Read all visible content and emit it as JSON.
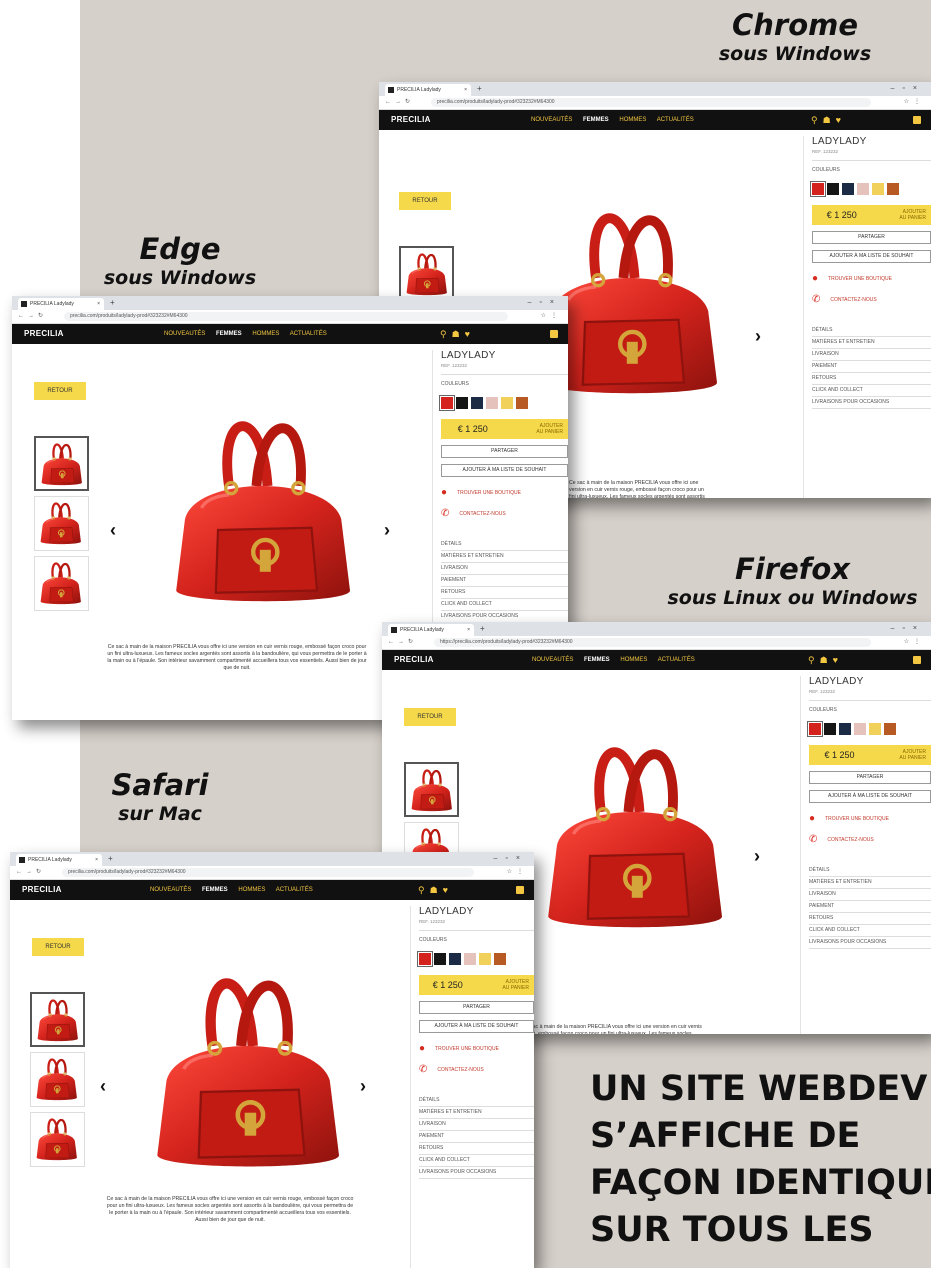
{
  "captions": {
    "chrome": {
      "title": "Chrome",
      "sub": "sous Windows"
    },
    "edge": {
      "title": "Edge",
      "sub": "sous Windows"
    },
    "firefox": {
      "title": "Firefox",
      "sub": "sous Linux ou Windows"
    },
    "safari": {
      "title": "Safari",
      "sub": "sur Mac"
    }
  },
  "tagline": [
    "UN SITE WEBDEV",
    "S’AFFICHE DE",
    "FAÇON IDENTIQUE",
    "SUR TOUS LES"
  ],
  "browser": {
    "tab_title": "PRECILIA Ladylady",
    "tab_close": "×",
    "new_tab": "+",
    "url_chrome": "precilia.com/produits/ladylady-prod#323232#M64300",
    "url_firefox": "https://precilia.com/produits/ladylady-prod#323232#M64300",
    "url_safari": "precilia.com/produits/ladylady-prod#323232#M64300",
    "window_controls": "–▫×",
    "nav_buttons": "←→↻",
    "ext_icons": "☆⋮"
  },
  "site": {
    "logo": "PRECILIA",
    "menu": [
      "NOUVEAUTÉS",
      "FEMMES",
      "HOMMES",
      "ACTUALITÉS"
    ],
    "icons": "⚲☗♥",
    "retour": "RETOUR",
    "prev": "‹",
    "next": "›",
    "description": "Ce sac à main de la maison PRECILIA vous offre ici une version en cuir vernis rouge, embossé façon croco pour un fini ultra-luxueux. Les fameux socles argentés sont assortis à la bandoulière, qui vous permettra de le porter à la main ou à l’épaule. Son intérieur savamment compartimenté accueillera tous vos essentiels. Aussi bien de jour que de nuit.",
    "product_title": "LADYLADY",
    "product_ref": "REF. 123232",
    "colors_label": "COULEURS",
    "swatches": [
      "#d3231c",
      "#151515",
      "#1b2a45",
      "#e6c2bc",
      "#f2d15a",
      "#b85a24"
    ],
    "price": "€ 1 250",
    "add_line1": "AJOUTER",
    "add_line2": "AU PANIER",
    "share": "PARTAGER",
    "wishlist": "AJOUTER À MA LISTE DE SOUHAIT",
    "store": "TROUVER UNE BOUTIQUE",
    "contact": "CONTACTEZ-NOUS",
    "details": [
      "DÉTAILS",
      "MATIÈRES ET ENTRETIEN",
      "LIVRAISON",
      "PAIEMENT",
      "RETOURS",
      "CLICK AND COLLECT",
      "LIVRAISONS POUR OCCASIONS"
    ]
  },
  "colors": {
    "brand_yellow": "#f5d94a",
    "nav_black": "#111111",
    "bag_red": "#d3231c",
    "background": "#d6d0ca"
  }
}
